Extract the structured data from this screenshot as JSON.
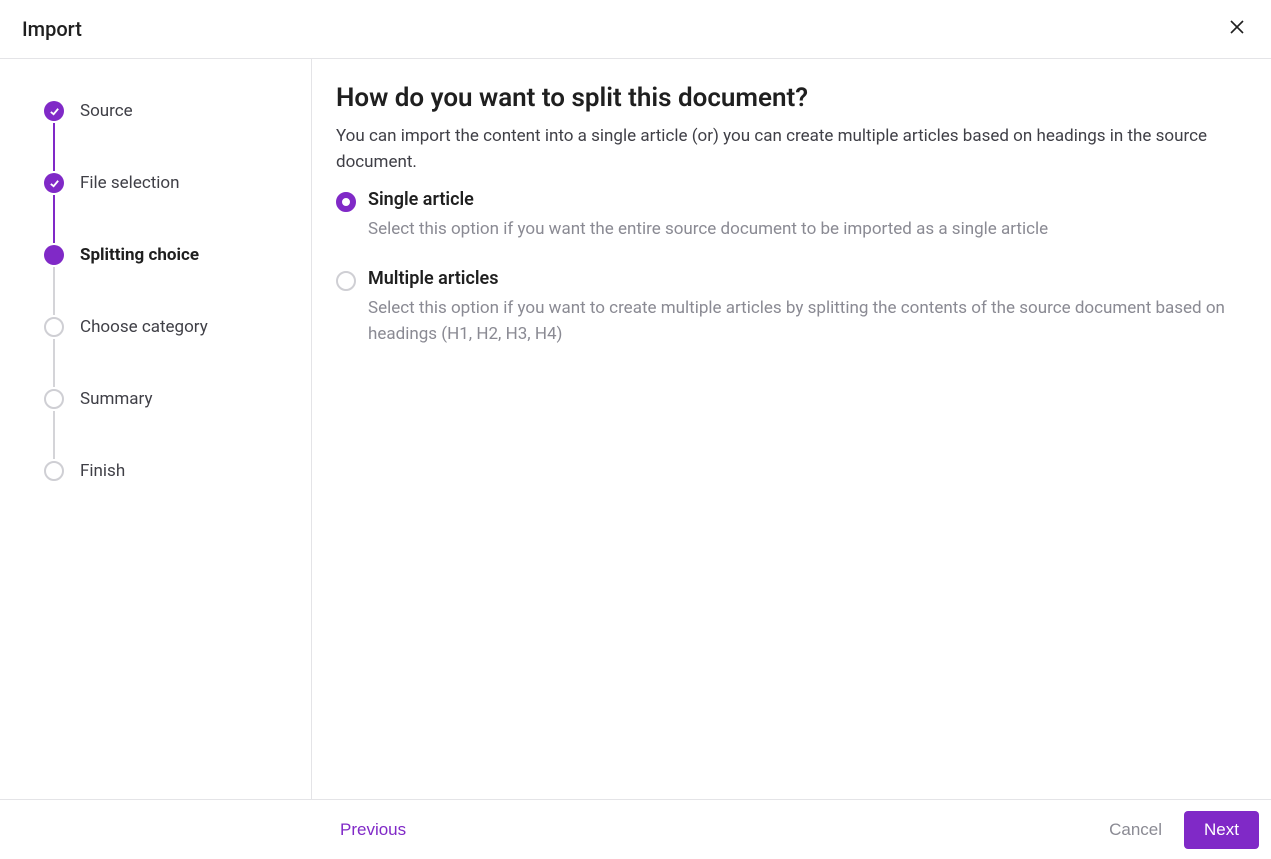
{
  "header": {
    "title": "Import"
  },
  "stepper": {
    "steps": [
      {
        "label": "Source",
        "state": "completed"
      },
      {
        "label": "File selection",
        "state": "completed"
      },
      {
        "label": "Splitting choice",
        "state": "current"
      },
      {
        "label": "Choose category",
        "state": "pending"
      },
      {
        "label": "Summary",
        "state": "pending"
      },
      {
        "label": "Finish",
        "state": "pending"
      }
    ]
  },
  "main": {
    "heading": "How do you want to split this document?",
    "subheading": "You can import the content into a single article (or) you can create multiple articles based on headings in the source document.",
    "options": [
      {
        "title": "Single article",
        "description": "Select this option if you want the entire source document to be imported as a single article",
        "selected": true
      },
      {
        "title": "Multiple articles",
        "description": "Select this option if you want to create multiple articles by splitting the contents of the source document based on headings (H1, H2, H3, H4)",
        "selected": false
      }
    ]
  },
  "footer": {
    "previous": "Previous",
    "cancel": "Cancel",
    "next": "Next"
  }
}
